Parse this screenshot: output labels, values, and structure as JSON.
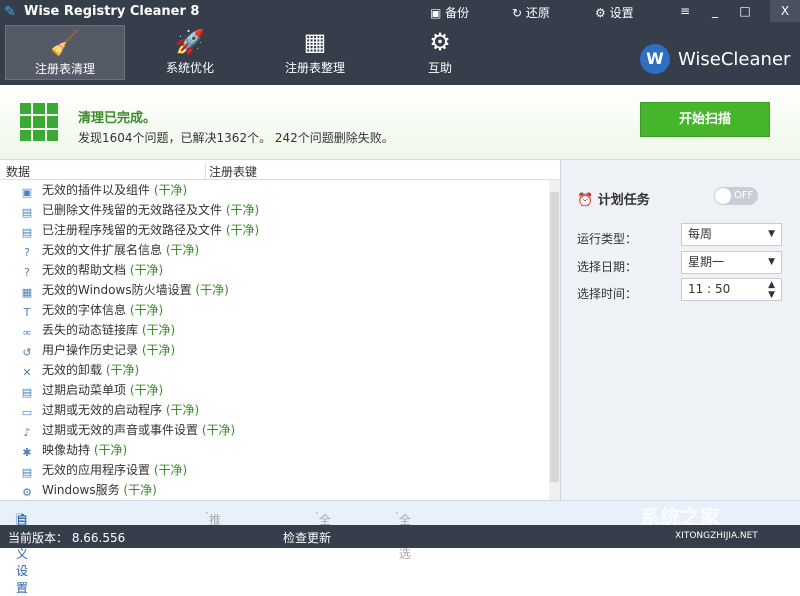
{
  "app": {
    "title": "Wise Registry Cleaner 8"
  },
  "toolbar": {
    "backup": "备份",
    "restore": "还原",
    "settings": "设置",
    "menu": "≡",
    "minimize": "_",
    "maximize": "□",
    "close": "X"
  },
  "nav": [
    {
      "label": "注册表清理"
    },
    {
      "label": "系统优化"
    },
    {
      "label": "注册表整理"
    },
    {
      "label": "互助"
    }
  ],
  "brand": {
    "logo_letter": "W",
    "name": "WiseCleaner"
  },
  "status": {
    "title": "清理已完成。",
    "detail": "发现1604个问题，已解决1362个。 242个问题删除失败。",
    "scan_button": "开始扫描"
  },
  "table": {
    "col1": "数据",
    "col2": "注册表键"
  },
  "items": [
    {
      "label": "无效的插件以及组件",
      "state": "(干净)"
    },
    {
      "label": "已删除文件残留的无效路径及文件",
      "state": "(干净)"
    },
    {
      "label": "已注册程序残留的无效路径及文件",
      "state": "(干净)"
    },
    {
      "label": "无效的文件扩展名信息",
      "state": "(干净)"
    },
    {
      "label": "无效的帮助文档",
      "state": "(干净)"
    },
    {
      "label": "无效的Windows防火墙设置",
      "state": "(干净)"
    },
    {
      "label": "无效的字体信息",
      "state": "(干净)"
    },
    {
      "label": "丢失的动态链接库",
      "state": "(干净)"
    },
    {
      "label": "用户操作历史记录",
      "state": "(干净)"
    },
    {
      "label": "无效的卸载",
      "state": "(干净)"
    },
    {
      "label": "过期启动菜单项",
      "state": "(干净)"
    },
    {
      "label": "过期或无效的启动程序",
      "state": "(干净)"
    },
    {
      "label": "过期或无效的声音或事件设置",
      "state": "(干净)"
    },
    {
      "label": "映像劫持",
      "state": "(干净)"
    },
    {
      "label": "无效的应用程序设置",
      "state": "(干净)"
    },
    {
      "label": "Windows服务",
      "state": "(干净)"
    }
  ],
  "schedule": {
    "title": "计划任务",
    "toggle": "OFF",
    "run_type_label": "运行类型：",
    "run_type": "每周",
    "day_label": "选择日期：",
    "day": "星期一",
    "time_label": "选择时间：",
    "time": "11 : 50"
  },
  "footer": {
    "custom": "自定义设置",
    "recommend": "推荐",
    "select_all": "全选",
    "select_none": "全不选"
  },
  "bottom": {
    "version": "当前版本： 8.66.556",
    "check_update": "检查更新",
    "watermark": "系统之家",
    "watermark_url": "XITONGZHIJIA.NET"
  }
}
